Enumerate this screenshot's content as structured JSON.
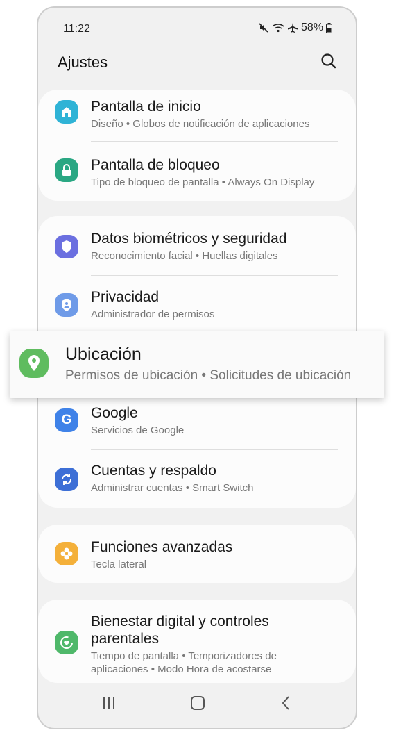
{
  "status_bar": {
    "time": "11:22",
    "battery": "58%",
    "icons": [
      "mute-icon",
      "wifi-icon",
      "airplane-icon",
      "battery-icon"
    ]
  },
  "header": {
    "title": "Ajustes",
    "search_icon": "search-icon"
  },
  "cards": [
    {
      "items": [
        {
          "title": "Pantalla de inicio",
          "sub": "Diseño  •  Globos de notificación de aplicaciones",
          "icon": "home-icon",
          "color": "#2fb3d6"
        },
        {
          "title": "Pantalla de bloqueo",
          "sub": "Tipo de bloqueo de pantalla  •  Always On Display",
          "icon": "lock-icon",
          "color": "#2aa783"
        }
      ]
    },
    {
      "items": [
        {
          "title": "Datos biométricos y seguridad",
          "sub": "Reconocimiento facial  •  Huellas digitales",
          "icon": "shield-icon",
          "color": "#6b6fe0"
        },
        {
          "title": "Privacidad",
          "sub": "Administrador de permisos",
          "icon": "privacy-shield-icon",
          "color": "#6f9be8"
        },
        {
          "title": "Google",
          "sub": "Servicios de Google",
          "icon": "google-icon",
          "color": "#3f82e8"
        },
        {
          "title": "Cuentas y respaldo",
          "sub": "Administrar cuentas  •  Smart Switch",
          "icon": "sync-icon",
          "color": "#3d6fd6"
        }
      ]
    },
    {
      "items": [
        {
          "title": "Funciones avanzadas",
          "sub": "Tecla lateral",
          "icon": "puzzle-icon",
          "color": "#f4b03a"
        }
      ]
    },
    {
      "items": [
        {
          "title_line1": "Bienestar digital y controles",
          "title_line2": "parentales",
          "sub_line1": "Tiempo de pantalla  •  Temporizadores de",
          "sub_line2": "aplicaciones  •  Modo Hora de acostarse",
          "icon": "wellbeing-icon",
          "color": "#4fb86a"
        }
      ]
    }
  ],
  "highlight": {
    "title": "Ubicación",
    "sub": "Permisos de ubicación  •  Solicitudes de ubicación",
    "icon": "location-pin-icon",
    "color": "#5fbc5f"
  },
  "nav_bar": {
    "buttons": [
      "recents-icon",
      "home-nav-icon",
      "back-icon"
    ]
  }
}
